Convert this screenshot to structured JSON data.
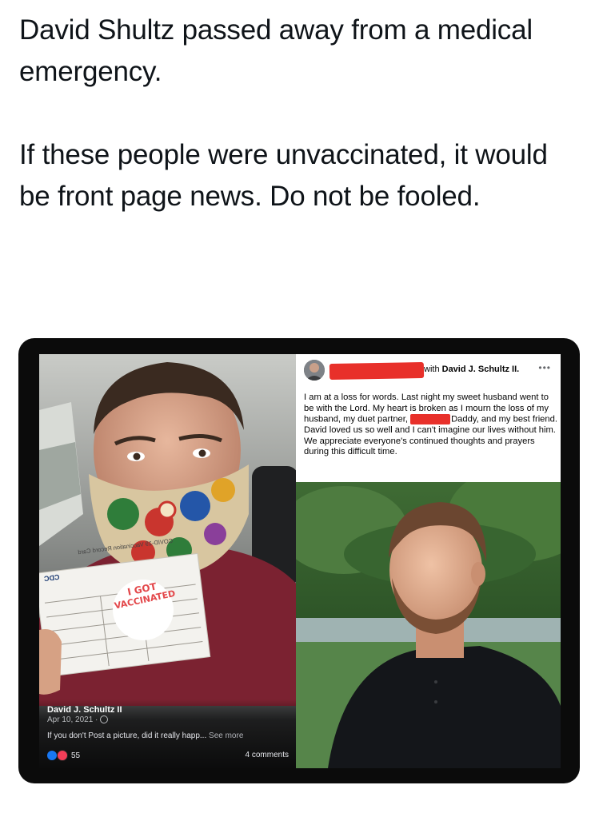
{
  "tweet": {
    "paragraph1": "David Shultz passed away from a medical emergency.",
    "paragraph2": "If these people were unvaccinated, it would be front page news. Do not be fooled."
  },
  "left_post": {
    "author": "David J. Schultz II",
    "date": "Apr 10, 2021 · ",
    "caption": "If you don't Post a picture, did it really happ...",
    "see_more": " See more",
    "reaction_count": "55",
    "comments": "4 comments",
    "sticker_line1": "I GOT",
    "sticker_line2": "VACCINATED",
    "card_title": "COVID-19 Vaccination Record Card",
    "card_brand": "CDC"
  },
  "right_post": {
    "with_label": "with ",
    "tagged_name": "David J. Schultz II.",
    "more_label": "•••",
    "text_before": "I am at a loss for words. Last night my sweet husband went to be with the Lord. My heart is broken as I mourn the loss of my husband, my duet partner, ",
    "text_after": "Daddy, and my best friend. David loved us so well and I can't imagine our lives without him. We appreciate everyone's continued thoughts and prayers during this difficult time."
  },
  "colors": {
    "redaction": "#e8302a",
    "facebook_blue": "#1877f2",
    "love_red": "#f33e58",
    "shirt_maroon": "#7b2231"
  },
  "icons": [
    "globe-icon",
    "like-reaction-icon",
    "love-reaction-icon",
    "more-icon"
  ]
}
